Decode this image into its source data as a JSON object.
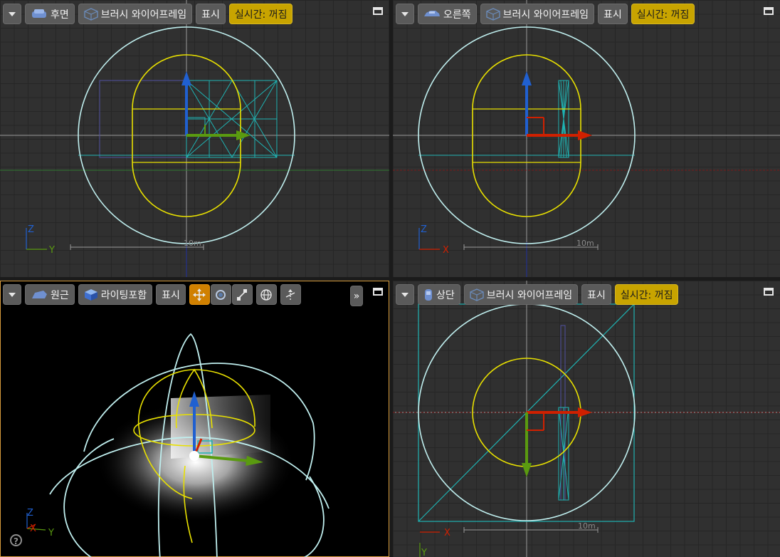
{
  "viewports": {
    "back": {
      "view_label": "후면",
      "mode_label": "브러시 와이어프레임",
      "show_label": "표시",
      "realtime_label": "실시간: 꺼짐",
      "scale_label": "10m",
      "axis_v": "Z",
      "axis_h": "Y"
    },
    "right": {
      "view_label": "오른쪽",
      "mode_label": "브러시 와이어프레임",
      "show_label": "표시",
      "realtime_label": "실시간: 꺼짐",
      "scale_label": "10m",
      "axis_v": "Z",
      "axis_h": "X"
    },
    "perspective": {
      "view_label": "원근",
      "mode_label": "라이팅포함",
      "show_label": "표시",
      "expand_label": "»",
      "axis_z": "Z",
      "axis_x": "X",
      "axis_y": "Y",
      "help_label": "?"
    },
    "top": {
      "view_label": "상단",
      "mode_label": "브러시 와이어프레임",
      "show_label": "표시",
      "realtime_label": "실시간: 꺼짐",
      "scale_label": "10m",
      "axis_h": "X",
      "axis_v": "Y"
    }
  },
  "colors": {
    "realtime_off": "#c8a400",
    "wire_cyan": "#bfeeee",
    "capsule_yellow": "#e8e000",
    "axis_red": "#d02000",
    "axis_green": "#5a9a10",
    "axis_blue": "#2060d0"
  }
}
